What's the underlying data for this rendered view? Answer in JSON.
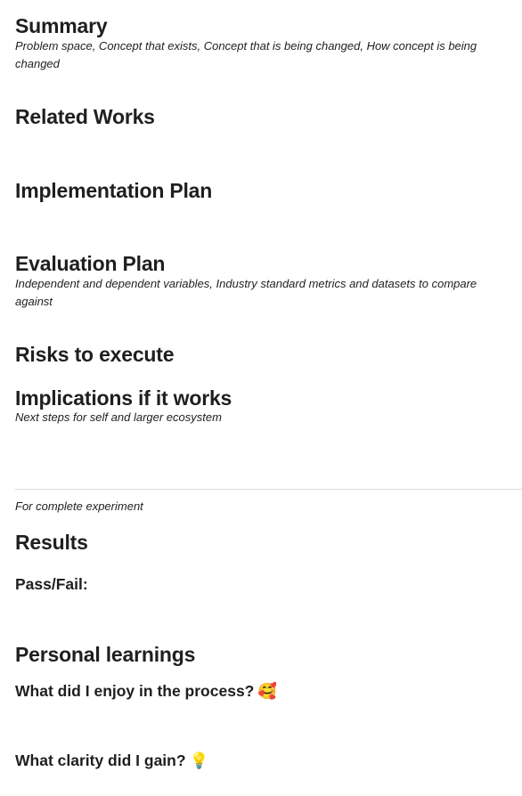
{
  "sections": {
    "summary": {
      "title": "Summary",
      "note": "Problem space, Concept that exists, Concept that is being changed, How concept is being changed"
    },
    "related_works": {
      "title": "Related Works"
    },
    "implementation_plan": {
      "title": "Implementation Plan"
    },
    "evaluation_plan": {
      "title": "Evaluation Plan",
      "note": "Independent and dependent variables, Industry standard metrics and datasets to compare against"
    },
    "risks": {
      "title": "Risks to execute"
    },
    "implications": {
      "title": "Implications if it works",
      "note": "Next steps for self and larger ecosystem"
    }
  },
  "divider_note": "For complete experiment",
  "results": {
    "title": "Results",
    "pass_fail": "Pass/Fail:"
  },
  "personal_learnings": {
    "title": "Personal learnings",
    "enjoy_question": "What did I enjoy in the process?",
    "enjoy_emoji": "🥰",
    "clarity_question": "What clarity did I gain?",
    "clarity_emoji": "💡"
  }
}
